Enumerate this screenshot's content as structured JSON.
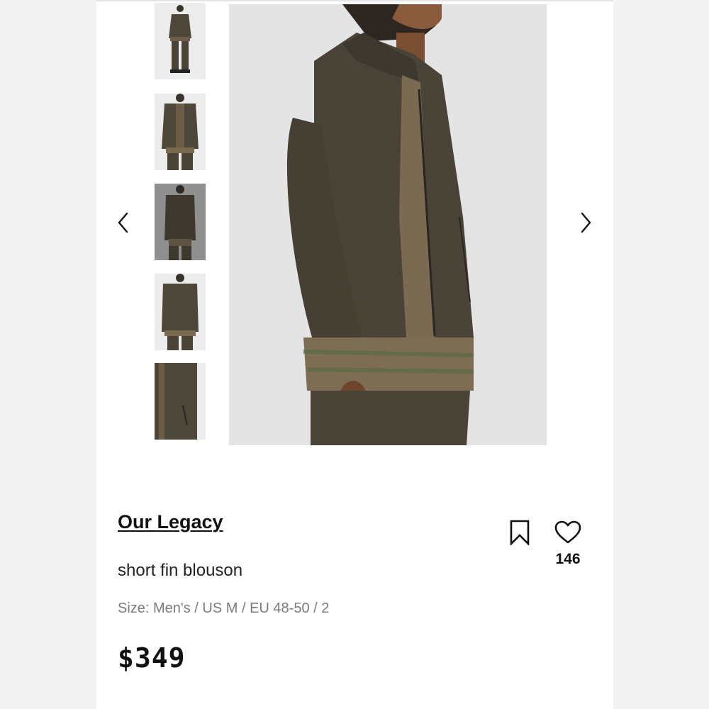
{
  "product": {
    "brand": "Our Legacy",
    "title": "short fin blouson",
    "size": "Size: Men's / US M / EU 48-50 / 2",
    "price": "$349",
    "likes": "146"
  },
  "gallery": {
    "thumbnail_count": 5,
    "selected_index": 2,
    "icons": [
      "chevron-left-icon",
      "chevron-right-icon",
      "bookmark-icon",
      "heart-icon"
    ]
  },
  "colors": {
    "jacket": "#4a4438",
    "background": "#e6e6e6",
    "text": "#111111",
    "muted": "#7a7a7a"
  }
}
